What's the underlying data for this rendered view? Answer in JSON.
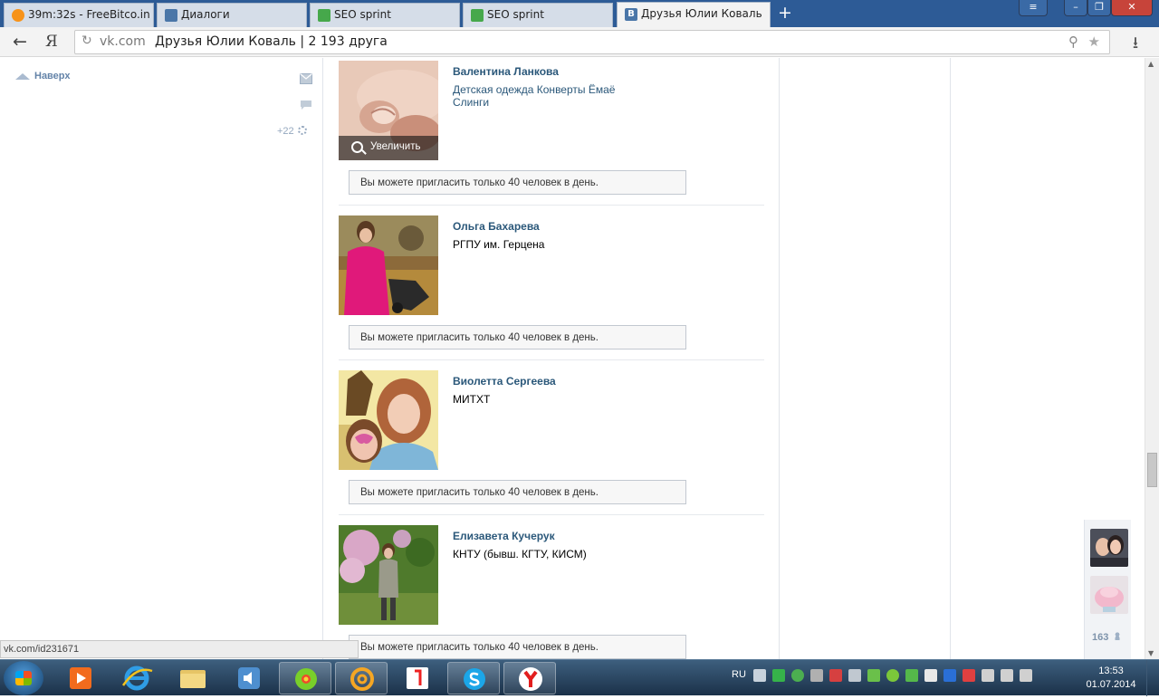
{
  "browser": {
    "tabs": [
      {
        "label": "39m:32s - FreeBitco.in",
        "icon": "bitcoin-icon",
        "color": "#f7931a"
      },
      {
        "label": "Диалоги",
        "icon": "vk-dialogs-icon",
        "color": "#4a76a8"
      },
      {
        "label": "SEO sprint",
        "icon": "seosprint-icon",
        "color": "#46a84b"
      },
      {
        "label": "SEO sprint",
        "icon": "seosprint-icon",
        "color": "#46a84b"
      },
      {
        "label": "Друзья Юлии Коваль",
        "icon": "vk-icon",
        "color": "#4a76a8"
      }
    ],
    "new_tab": "+",
    "window_buttons": {
      "menu": "≡",
      "minimize": "–",
      "maximize": "❐",
      "close": "✕"
    },
    "address": {
      "host": "vk.com",
      "page_title": "Друзья Юлии Коваль | 2 193 друга"
    },
    "back": "←",
    "yandex": "Я"
  },
  "sidebar": {
    "up_label": "Наверх",
    "counter": "+22"
  },
  "friends": [
    {
      "name": "Валентина Ланкова",
      "info": "Детская одежда Конверты Ёмаё Слинги",
      "info_link": true,
      "enlarge": "Увеличить",
      "invite": "Вы можете пригласить только 40 человек в день."
    },
    {
      "name": "Ольга Бахарева",
      "info": "РГПУ им. Герцена",
      "info_link": false,
      "invite": "Вы можете пригласить только 40 человек в день."
    },
    {
      "name": "Виолетта Сергеева",
      "info": "МИТХТ",
      "info_link": false,
      "invite": "Вы можете пригласить только 40 человек в день."
    },
    {
      "name": "Елизавета Кучерук",
      "info": "КНТУ (бывш. КГТУ, КИСМ)",
      "info_link": false,
      "invite": "Вы можете пригласить только 40 человек в день."
    }
  ],
  "chat_dock": {
    "online_count": "163"
  },
  "status_url": "vk.com/id231671",
  "taskbar": {
    "language": "RU",
    "time": "13:53",
    "date": "01.07.2014"
  },
  "colors": {
    "link": "#2b587a",
    "accent": "#4a76a8",
    "titlebar": "#2d5b96"
  }
}
